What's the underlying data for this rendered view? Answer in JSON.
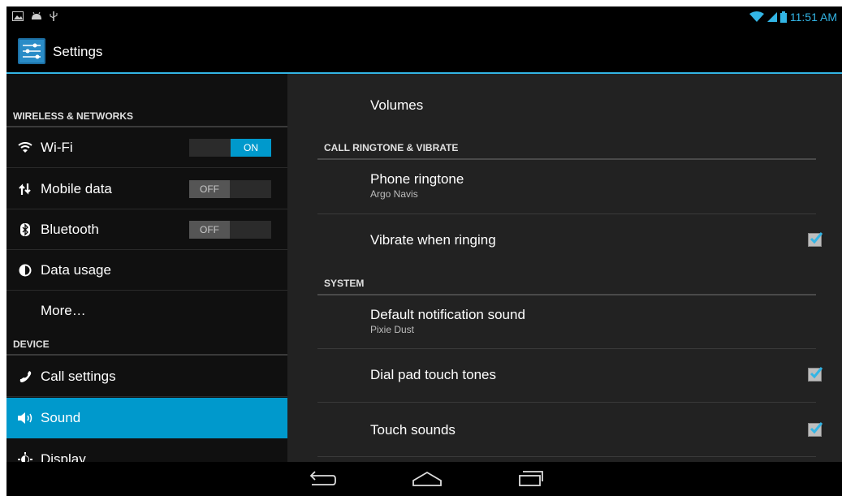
{
  "status_bar": {
    "left_icons": [
      "gallery-icon",
      "android-icon",
      "usb-icon"
    ],
    "time": "11:51 AM",
    "right_icons": [
      "wifi-icon",
      "signal-icon",
      "battery-icon"
    ],
    "accent": "#33b5e5"
  },
  "action_bar": {
    "title": "Settings",
    "icon": "settings-sliders-icon"
  },
  "left_pane": {
    "headers": {
      "wireless": "WIRELESS & NETWORKS",
      "device": "DEVICE"
    },
    "items": [
      {
        "label": "Wi-Fi",
        "icon": "wifi-icon",
        "toggle": "ON"
      },
      {
        "label": "Mobile data",
        "icon": "data-arrows-icon",
        "toggle": "OFF"
      },
      {
        "label": "Bluetooth",
        "icon": "bluetooth-icon",
        "toggle": "OFF"
      },
      {
        "label": "Data usage",
        "icon": "data-usage-icon"
      },
      {
        "label": "More…"
      },
      {
        "label": "Call settings",
        "icon": "phone-icon"
      },
      {
        "label": "Sound",
        "icon": "speaker-icon",
        "selected": true
      },
      {
        "label": "Display",
        "icon": "display-icon"
      }
    ],
    "selected_color": "#0099cc"
  },
  "right_pane": {
    "volumes": "Volumes",
    "header_call": "CALL RINGTONE & VIBRATE",
    "phone_ringtone": {
      "title": "Phone ringtone",
      "value": "Argo Navis"
    },
    "vibrate": {
      "title": "Vibrate when ringing",
      "checked": true
    },
    "header_system": "SYSTEM",
    "notification_sound": {
      "title": "Default notification sound",
      "value": "Pixie Dust"
    },
    "dial_pad": {
      "title": "Dial pad touch tones",
      "checked": true
    },
    "touch_sounds": {
      "title": "Touch sounds",
      "checked": true
    }
  },
  "nav_bar": {
    "buttons": [
      "back-icon",
      "home-icon",
      "recent-apps-icon"
    ]
  }
}
